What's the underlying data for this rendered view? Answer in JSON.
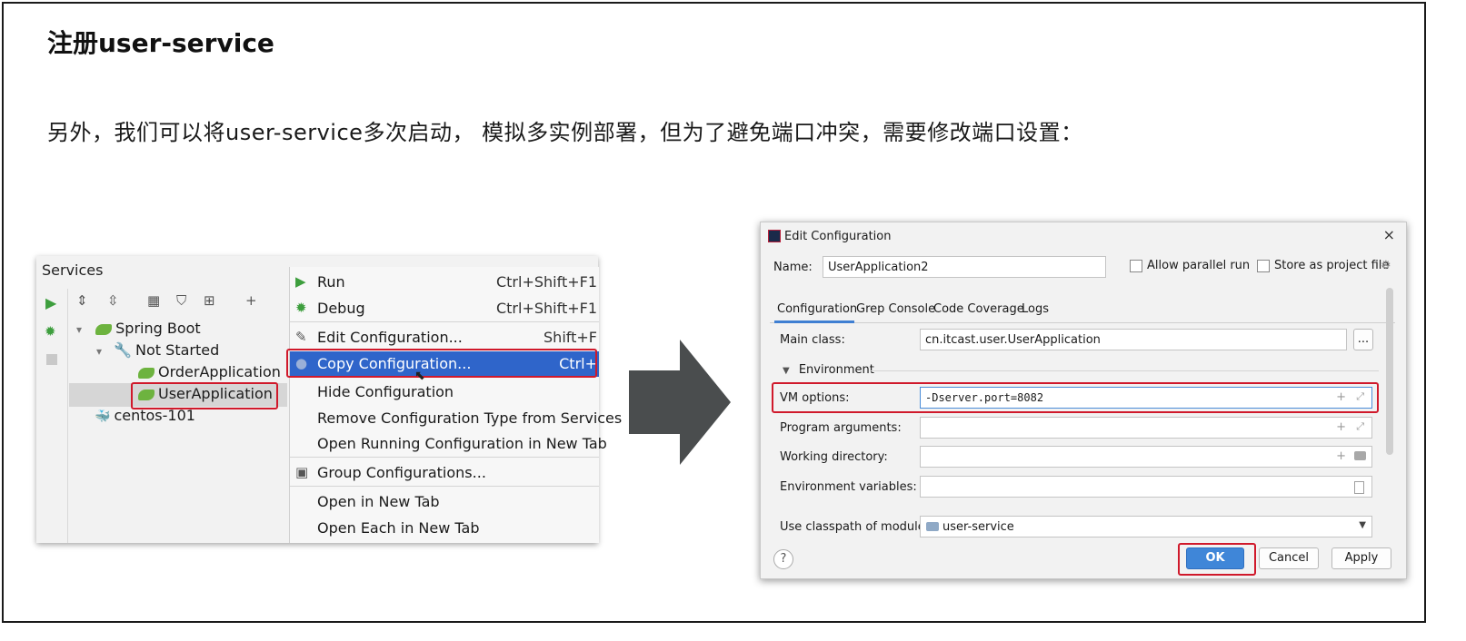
{
  "slide": {
    "title": "注册user-service",
    "text": "另外，我们可以将user-service多次启动， 模拟多实例部署，但为了避免端口冲突，需要修改端口设置："
  },
  "services": {
    "title": "Services",
    "tree": {
      "spring_boot": "Spring Boot",
      "not_started": "Not Started",
      "order_app": "OrderApplication",
      "user_app": "UserApplication",
      "centos": "centos-101"
    }
  },
  "menu": {
    "items": [
      {
        "label": "Run",
        "shortcut": "Ctrl+Shift+F1"
      },
      {
        "label": "Debug",
        "shortcut": "Ctrl+Shift+F1"
      },
      {
        "label": "Edit Configuration...",
        "shortcut": "Shift+F"
      },
      {
        "label": "Copy Configuration...",
        "shortcut": "Ctrl+"
      },
      {
        "label": "Hide Configuration",
        "shortcut": ""
      },
      {
        "label": "Remove Configuration Type from Services",
        "shortcut": ""
      },
      {
        "label": "Open Running Configuration in New Tab",
        "shortcut": ""
      },
      {
        "label": "Group Configurations...",
        "shortcut": ""
      },
      {
        "label": "Open in New Tab",
        "shortcut": ""
      },
      {
        "label": "Open Each in New Tab",
        "shortcut": ""
      }
    ]
  },
  "dialog": {
    "title": "Edit Configuration",
    "name_label": "Name:",
    "name_value": "UserApplication2",
    "allow_parallel": "Allow parallel run",
    "store_project": "Store as project file",
    "tabs": [
      "Configuration",
      "Grep Console",
      "Code Coverage",
      "Logs"
    ],
    "main_class_label": "Main class:",
    "main_class_value": "cn.itcast.user.UserApplication",
    "browse": "...",
    "environment": "Environment",
    "vm_options_label": "VM options:",
    "vm_options_value": "-Dserver.port=8082",
    "program_args_label": "Program arguments:",
    "working_dir_label": "Working directory:",
    "env_vars_label": "Environment variables:",
    "classpath_label": "Use classpath of module:",
    "classpath_value": "user-service",
    "ok": "OK",
    "cancel": "Cancel",
    "apply": "Apply",
    "help": "?"
  },
  "colors": {
    "highlight_red": "#d0192b",
    "menu_selected": "#2f65ca",
    "arrow": "#4a4d4e",
    "ok_button": "#3f86d8"
  }
}
